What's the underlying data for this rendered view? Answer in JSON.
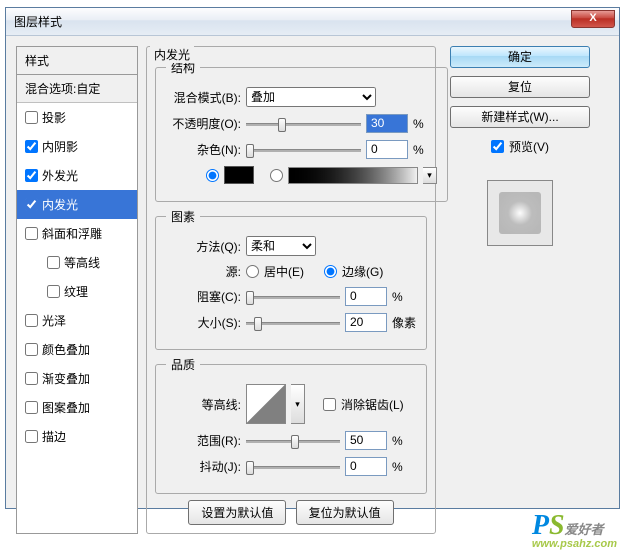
{
  "window": {
    "title": "图层样式"
  },
  "left": {
    "header": "样式",
    "subheader": "混合选项:自定",
    "items": [
      {
        "label": "投影",
        "checked": false,
        "indent": false
      },
      {
        "label": "内阴影",
        "checked": true,
        "indent": false
      },
      {
        "label": "外发光",
        "checked": true,
        "indent": false
      },
      {
        "label": "内发光",
        "checked": true,
        "indent": false,
        "selected": true
      },
      {
        "label": "斜面和浮雕",
        "checked": false,
        "indent": false
      },
      {
        "label": "等高线",
        "checked": false,
        "indent": true
      },
      {
        "label": "纹理",
        "checked": false,
        "indent": true
      },
      {
        "label": "光泽",
        "checked": false,
        "indent": false
      },
      {
        "label": "颜色叠加",
        "checked": false,
        "indent": false
      },
      {
        "label": "渐变叠加",
        "checked": false,
        "indent": false
      },
      {
        "label": "图案叠加",
        "checked": false,
        "indent": false
      },
      {
        "label": "描边",
        "checked": false,
        "indent": false
      }
    ]
  },
  "mid": {
    "title": "内发光",
    "structure": {
      "legend": "结构",
      "blend_label": "混合模式(B):",
      "blend_value": "叠加",
      "opacity_label": "不透明度(O):",
      "opacity_value": "30",
      "noise_label": "杂色(N):",
      "noise_value": "0",
      "pct": "%"
    },
    "element": {
      "legend": "图素",
      "method_label": "方法(Q):",
      "method_value": "柔和",
      "source_label": "源:",
      "center_label": "居中(E)",
      "edge_label": "边缘(G)",
      "choke_label": "阻塞(C):",
      "choke_value": "0",
      "size_label": "大小(S):",
      "size_value": "20",
      "pct": "%",
      "px": "像素"
    },
    "quality": {
      "legend": "品质",
      "contour_label": "等高线:",
      "antialias_label": "消除锯齿(L)",
      "range_label": "范围(R):",
      "range_value": "50",
      "jitter_label": "抖动(J):",
      "jitter_value": "0",
      "pct": "%"
    },
    "default_btn": "设置为默认值",
    "reset_btn": "复位为默认值"
  },
  "right": {
    "ok": "确定",
    "cancel": "复位",
    "newstyle": "新建样式(W)...",
    "preview": "预览(V)"
  },
  "watermark": {
    "brand1": "P",
    "brand2": "S",
    "txt": "爱好者",
    "url": "www.psahz.com"
  }
}
